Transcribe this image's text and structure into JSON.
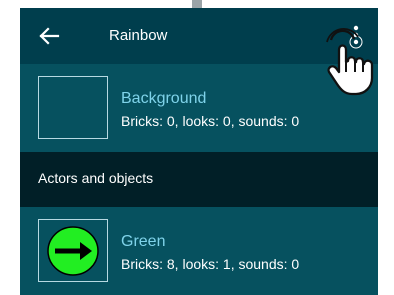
{
  "toolbar": {
    "back_icon": "arrow-left-icon",
    "title": "Rainbow",
    "menu_icon": "more-vert-icon"
  },
  "background_item": {
    "name": "Background",
    "details": "Bricks: 0, looks: 0, sounds: 0"
  },
  "section": {
    "label": "Actors and objects"
  },
  "actors": [
    {
      "name": "Green",
      "details": "Bricks: 8, looks: 1, sounds: 0",
      "icon": "green-arrow-circle-icon"
    }
  ],
  "colors": {
    "toolbar_bg": "#003e4d",
    "row_bg": "#06515f",
    "section_bg": "#011f27",
    "item_name": "#7fd3ea",
    "sprite_green": "#22ee22"
  }
}
